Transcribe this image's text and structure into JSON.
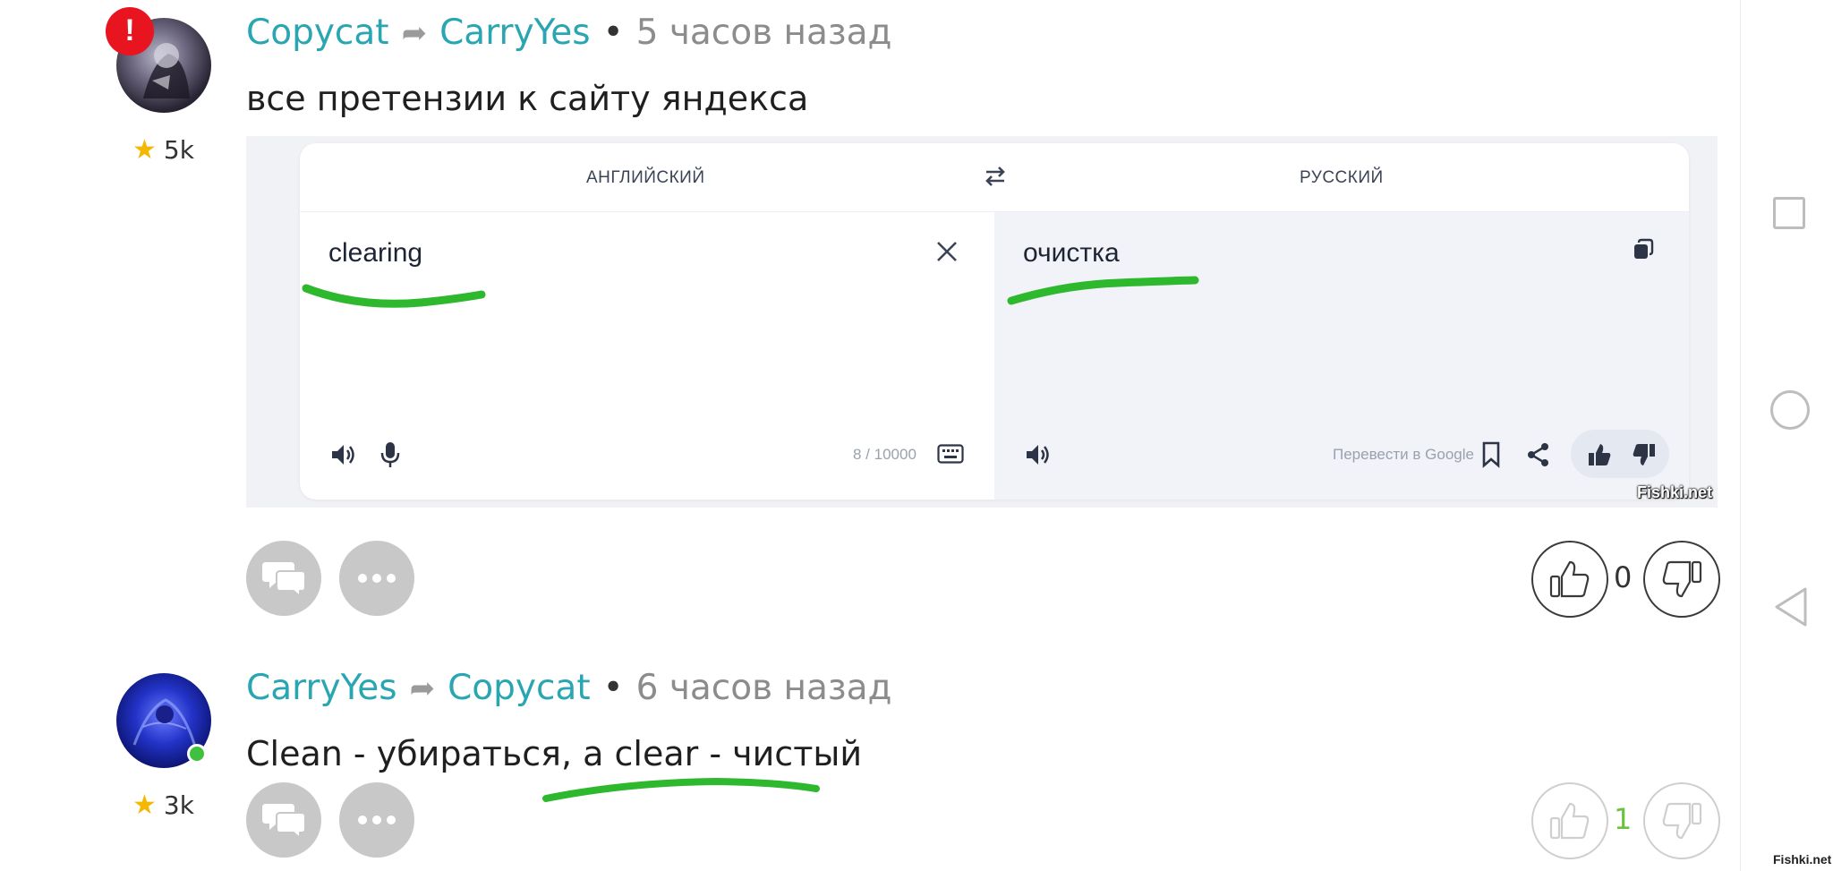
{
  "comments": [
    {
      "author": "Copycat",
      "reply_to": "CarryYes",
      "time": "5 часов назад",
      "separator": "•",
      "text": "все претензии к сайту яндекса",
      "rating": "5k",
      "badge": "!",
      "votes": "0",
      "attachment": {
        "source_lang": "АНГЛИЙСКИЙ",
        "target_lang": "РУССКИЙ",
        "source_text": "clearing",
        "target_text": "очистка",
        "char_count": "8 / 10000",
        "google_link": "Перевести в Google",
        "watermark": "Fishki.net"
      }
    },
    {
      "author": "CarryYes",
      "reply_to": "Copycat",
      "time": "6 часов назад",
      "separator": "•",
      "text": "Clean - убираться, а clear - чистый",
      "rating": "3k",
      "votes": "1"
    }
  ],
  "page_watermark": "Fishki.net",
  "colors": {
    "author": "#2aa6b3",
    "meta": "#8c8c8c",
    "highlight_stroke": "#2db82d",
    "alert": "#e8141f",
    "positive_votes": "#6cc13f"
  },
  "icons": [
    "star-icon",
    "reply-arrow-icon",
    "comments-icon",
    "more-icon",
    "thumbs-up-icon",
    "thumbs-down-icon",
    "swap-icon",
    "close-icon",
    "copy-icon",
    "speaker-icon",
    "mic-icon",
    "keyboard-icon",
    "bookmark-icon",
    "share-icon",
    "square-icon",
    "circle-icon",
    "triangle-back-icon"
  ]
}
